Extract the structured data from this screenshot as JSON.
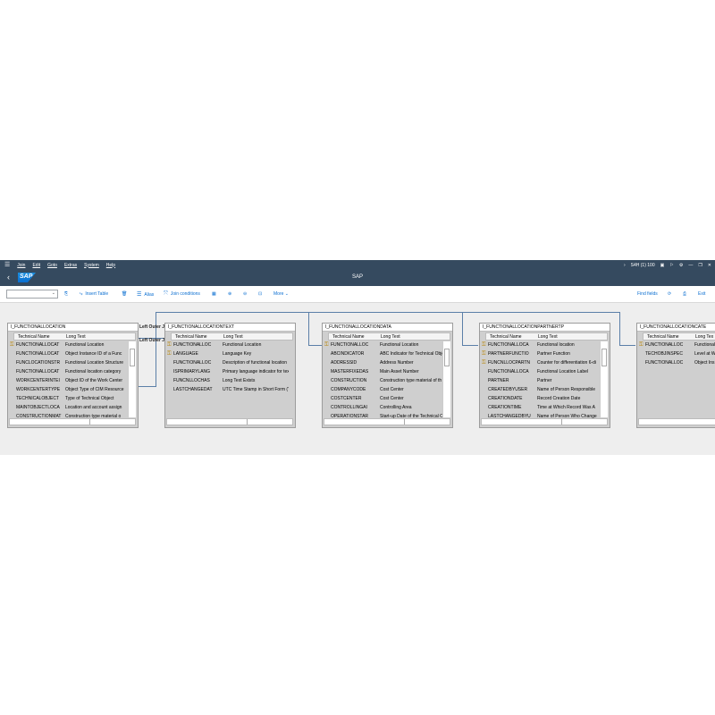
{
  "menubar": {
    "items": [
      "Join",
      "Edit",
      "Goto",
      "Extras",
      "System",
      "Help"
    ],
    "system_info": "S4H (1) 100",
    "nav_icon": "chevron-right-icon"
  },
  "titlebar": {
    "title": "SAP",
    "logo_text": "SAP"
  },
  "toolbar": {
    "insert_table": "Insert Table",
    "alias": "Alias",
    "join_conditions": "Join conditions",
    "more": "More",
    "find_fields": "Find fields",
    "exit": "Exit"
  },
  "joins": {
    "join1": "Left Outer Join",
    "join2": "Left Outer Join"
  },
  "tables": [
    {
      "name": "I_FUNCTIONALLOCATION",
      "col1": "Technical Name",
      "col2": "Long Text",
      "rows": [
        {
          "key": true,
          "tech": "FUNCTIONALLOCAT",
          "text": "Functional Location"
        },
        {
          "key": false,
          "tech": "FUNCTIONALLOCAT",
          "text": "Object Instance ID of a Func"
        },
        {
          "key": false,
          "tech": "FUNCLOCATIONSTR",
          "text": "Functional Location Structure"
        },
        {
          "key": false,
          "tech": "FUNCTIONALLOCAT",
          "text": "Functional location category"
        },
        {
          "key": false,
          "tech": "WORKCENTERINTEI",
          "text": "Object ID of the Work Center"
        },
        {
          "key": false,
          "tech": "WORKCENTERTYPE",
          "text": "Object Type of CIM Resource"
        },
        {
          "key": false,
          "tech": "TECHNICALOBJECT",
          "text": "Type of Technical Object"
        },
        {
          "key": false,
          "tech": "MAINTOBJECTLOCA",
          "text": "Location and account assign"
        },
        {
          "key": false,
          "tech": "CONSTRUCTIONMAT",
          "text": "Construction type material o"
        }
      ]
    },
    {
      "name": "I_FUNCTIONALLOCATIONTEXT",
      "col1": "Technical Name",
      "col2": "Long Text",
      "rows": [
        {
          "key": true,
          "tech": "FUNCTIONALLOC",
          "text": "Functional Location"
        },
        {
          "key": true,
          "tech": "LANGUAGE",
          "text": "Language Key"
        },
        {
          "key": false,
          "tech": "FUNCTIONALLOC",
          "text": "Description of functional location"
        },
        {
          "key": false,
          "tech": "ISPRIMARYLANG",
          "text": "Primary language indicator for text"
        },
        {
          "key": false,
          "tech": "FUNCNLLOCHAS",
          "text": "Long Text Exists"
        },
        {
          "key": false,
          "tech": "LASTCHANGEDAT",
          "text": "UTC Time Stamp in Short Form (YY"
        }
      ]
    },
    {
      "name": "I_FUNCTIONALLOCATIONDATA",
      "col1": "Technical Name",
      "col2": "Long Text",
      "rows": [
        {
          "key": true,
          "tech": "FUNCTIONALLOC",
          "text": "Functional Location"
        },
        {
          "key": false,
          "tech": "ABCINDICATOR",
          "text": "ABC Indicator for Technical Obje"
        },
        {
          "key": false,
          "tech": "ADDRESSID",
          "text": "Address Number"
        },
        {
          "key": false,
          "tech": "MASTERFIXEDAS",
          "text": "Main Asset Number"
        },
        {
          "key": false,
          "tech": "CONSTRUCTION",
          "text": "Construction type material of th"
        },
        {
          "key": false,
          "tech": "COMPANYCODE",
          "text": "Cost Center"
        },
        {
          "key": false,
          "tech": "COSTCENTER",
          "text": "Cost Center"
        },
        {
          "key": false,
          "tech": "CONTROLLINGAI",
          "text": "Controlling Area"
        },
        {
          "key": false,
          "tech": "OPERATIONSTAR",
          "text": "Start-up Date of the Technical O"
        }
      ]
    },
    {
      "name": "I_FUNCTIONALLOCATIONPARTNERTP",
      "col1": "Technical Name",
      "col2": "Long Text",
      "rows": [
        {
          "key": true,
          "tech": "FUNCTIONALLOCA",
          "text": "Functional location"
        },
        {
          "key": true,
          "tech": "PARTNERFUNCTIO",
          "text": "Partner Function"
        },
        {
          "key": true,
          "tech": "FUNCNLLOCPARTN",
          "text": "Counter for differentiation 6-di"
        },
        {
          "key": false,
          "tech": "FUNCTIONALLOCA",
          "text": "Functional Location Label"
        },
        {
          "key": false,
          "tech": "PARTNER",
          "text": "Partner"
        },
        {
          "key": false,
          "tech": "CREATEDBYUSER",
          "text": "Name of Person Responsible"
        },
        {
          "key": false,
          "tech": "CREATIONDATE",
          "text": "Record Creation Date"
        },
        {
          "key": false,
          "tech": "CREATIONTIME",
          "text": "Time at Which Record Was A"
        },
        {
          "key": false,
          "tech": "LASTCHANGEDBYU",
          "text": "Name of Person Who Change"
        }
      ]
    },
    {
      "name": "I_FUNCTIONALLOCATIONCATE",
      "col1": "Technical Name",
      "col2": "Long Tex",
      "rows": [
        {
          "key": true,
          "tech": "FUNCTIONALLOC",
          "text": "Functional"
        },
        {
          "key": false,
          "tech": "TECHOBJINSPEC",
          "text": "Level at W"
        },
        {
          "key": false,
          "tech": "FUNCTIONALLOC",
          "text": "Object Ins"
        }
      ]
    }
  ]
}
